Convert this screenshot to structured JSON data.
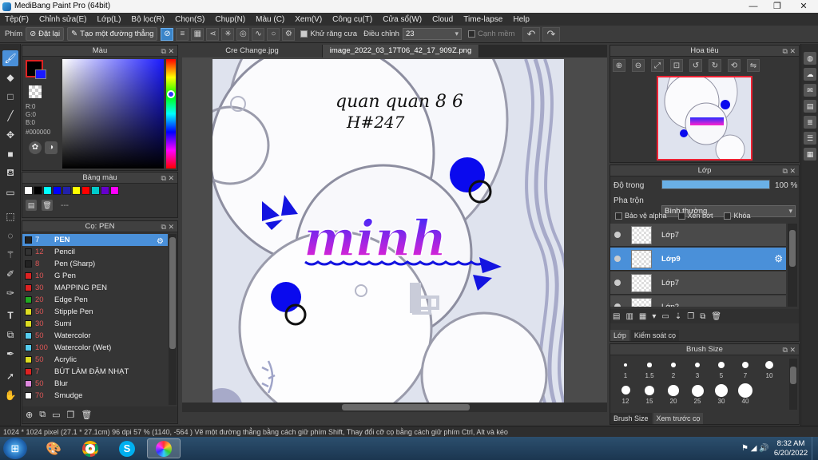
{
  "window": {
    "title": "MediBang Paint Pro (64bit)",
    "minimize": "—",
    "maximize": "❐",
    "close": "✕"
  },
  "menu": [
    "Tệp(F)",
    "Chỉnh sửa(E)",
    "Lớp(L)",
    "Bộ lọc(R)",
    "Chọn(S)",
    "Chụp(N)",
    "Màu (C)",
    "Xem(V)",
    "Công cụ(T)",
    "Cửa sổ(W)",
    "Cloud",
    "Time-lapse",
    "Help"
  ],
  "toolbar": {
    "brush_label": "Phím",
    "reset_label": "Đặt lại",
    "line_label": "Tạo một đường thẳng",
    "antialias_label": "Khử răng cưa",
    "adjust_label": "Điều chỉnh",
    "adjust_value": "23",
    "smooth_label": "Cạnh mềm"
  },
  "color_panel": {
    "title": "Màu",
    "r": "R:0",
    "g": "G:0",
    "b": "B:0",
    "hex": "#000000",
    "primary_color": "#000000",
    "secondary_color": "#1a1aff"
  },
  "palette_panel": {
    "title": "Bảng màu",
    "colors": [
      "#ffffff",
      "#000000",
      "#00ffff",
      "#0000ff",
      "#2222aa",
      "#ffff00",
      "#ff0000",
      "#00cccc",
      "#6600cc",
      "#ff00ff"
    ],
    "dash": "---"
  },
  "brush_panel": {
    "title": "Cọ: PEN",
    "items": [
      {
        "size": "7",
        "name": "PEN",
        "color": "#222222"
      },
      {
        "size": "12",
        "name": "Pencil",
        "color": "#333333"
      },
      {
        "size": "8",
        "name": "Pen (Sharp)",
        "color": "#222222"
      },
      {
        "size": "10",
        "name": "G Pen",
        "color": "#dd2222"
      },
      {
        "size": "30",
        "name": "MAPPING PEN",
        "color": "#dd2222"
      },
      {
        "size": "20",
        "name": "Edge Pen",
        "color": "#22aa22"
      },
      {
        "size": "50",
        "name": "Stipple Pen",
        "color": "#dddd22"
      },
      {
        "size": "30",
        "name": "Sumi",
        "color": "#dddd22"
      },
      {
        "size": "50",
        "name": "Watercolor",
        "color": "#55ccee"
      },
      {
        "size": "100",
        "name": "Watercolor (Wet)",
        "color": "#55ccee"
      },
      {
        "size": "50",
        "name": "Acrylic",
        "color": "#dddd22"
      },
      {
        "size": "7",
        "name": "BÚT LÀM ĐẬM NHẠT",
        "color": "#dd2222"
      },
      {
        "size": "50",
        "name": "Blur",
        "color": "#dd88dd"
      },
      {
        "size": "70",
        "name": "Smudge",
        "color": "#ffffff"
      }
    ]
  },
  "documents": {
    "tabs": [
      "Cre Change.jpg",
      "image_2022_03_17T06_42_17_909Z.png"
    ]
  },
  "artwork": {
    "handwriting_line1": "quan quan 8 6",
    "handwriting_line2": "H#247",
    "title_text": "minh"
  },
  "navigator": {
    "title": "Hoa tiêu"
  },
  "layer_panel": {
    "title": "Lớp",
    "opacity_label": "Độ trong",
    "opacity_value": "100 %",
    "opacity_percent": 100,
    "blend_label": "Pha trộn",
    "blend_value": "Bình thường",
    "protect_alpha": "Bảo vệ alpha",
    "clipping": "Xén bớt",
    "lock": "Khóa",
    "layers": [
      {
        "name": "Lớp7",
        "selected": false
      },
      {
        "name": "Lớp9",
        "selected": true
      },
      {
        "name": "Lớp7",
        "selected": false
      },
      {
        "name": "Lớp2",
        "selected": false
      }
    ],
    "tab_layer": "Lớp",
    "tab_control": "Kiểm soát cọ"
  },
  "brush_size_panel": {
    "title": "Brush Size",
    "sizes": [
      "1",
      "1.5",
      "2",
      "3",
      "5",
      "7",
      "10",
      "12",
      "15",
      "20",
      "25",
      "30",
      "40"
    ],
    "tab_size": "Brush Size",
    "tab_preview": "Xem trước cọ"
  },
  "statusbar": {
    "text": "1024 * 1024 pixel   (27.1 * 27.1cm)   96 dpi   57 %   (1140, -564 )   Vẽ một đường thẳng bằng cách giữ phím Shift, Thay đổi cỡ cọ bằng cách giữ phím Ctrl, Alt và kéo"
  },
  "taskbar": {
    "time": "8:32 AM",
    "date": "6/20/2022"
  }
}
